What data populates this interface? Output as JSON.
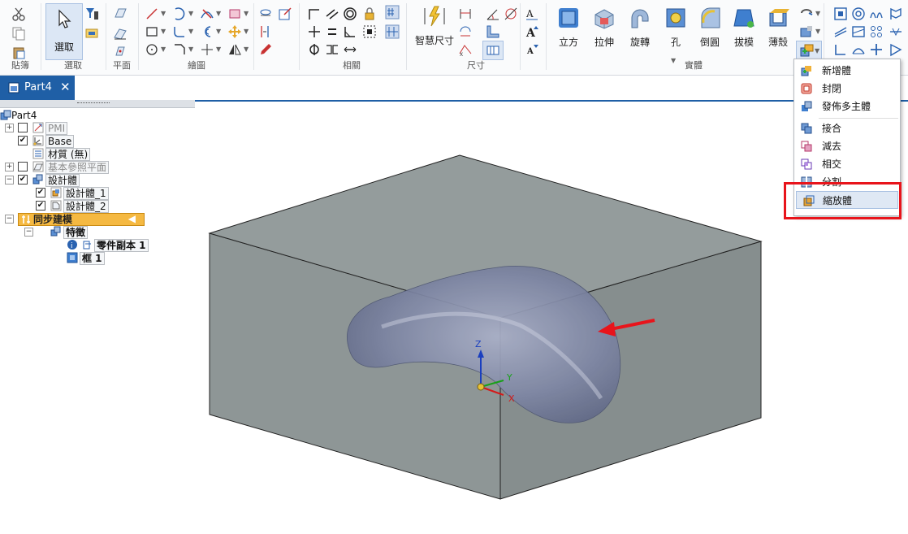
{
  "ribbon": {
    "groups": {
      "clipboard": "貼簿",
      "select": "選取",
      "plane": "平面",
      "draw": "繪圖",
      "relate": "相關",
      "dimension": "尺寸",
      "solid": "實體"
    },
    "buttons": {
      "select": "選取",
      "smart_dimension": "智慧尺寸",
      "cube": "立方",
      "extrude": "拉伸",
      "revolve": "旋轉",
      "hole": "孔",
      "round": "倒圓",
      "draft": "拔模",
      "thin": "薄殼"
    }
  },
  "tab": {
    "label": "Part4",
    "close": "✕"
  },
  "tree": {
    "root": "Part4",
    "pmi": "PMI",
    "base": "Base",
    "material": "材質 (無)",
    "ref_planes": "基本參照平面",
    "design_body": "設計體",
    "design_body_1": "設計體_1",
    "design_body_2": "設計體_2",
    "sync": "同步建模",
    "features": "特徵",
    "part_copy": "零件副本 1",
    "box": "框 1"
  },
  "menu": {
    "items": [
      "新增體",
      "封閉",
      "發佈多主體",
      "接合",
      "減去",
      "相交",
      "分割",
      "縮放體"
    ],
    "highlighted": "縮放體"
  },
  "triad": {
    "z": "Z",
    "y": "Y",
    "x": "X"
  },
  "colors": {
    "accent": "#1f5fa6",
    "highlight": "#e8141b",
    "sync_bar": "#f5b942",
    "box": "#8c9494"
  }
}
